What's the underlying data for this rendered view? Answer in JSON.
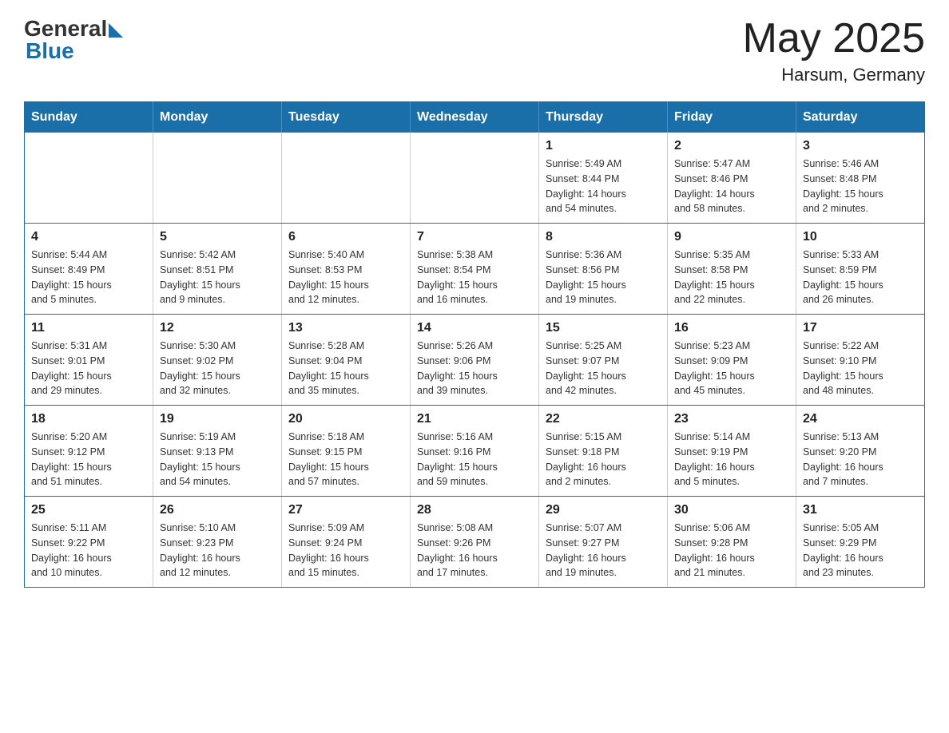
{
  "header": {
    "logo_general": "General",
    "logo_blue": "Blue",
    "title": "May 2025",
    "location": "Harsum, Germany"
  },
  "days_of_week": [
    "Sunday",
    "Monday",
    "Tuesday",
    "Wednesday",
    "Thursday",
    "Friday",
    "Saturday"
  ],
  "weeks": [
    [
      {
        "day": "",
        "info": ""
      },
      {
        "day": "",
        "info": ""
      },
      {
        "day": "",
        "info": ""
      },
      {
        "day": "",
        "info": ""
      },
      {
        "day": "1",
        "info": "Sunrise: 5:49 AM\nSunset: 8:44 PM\nDaylight: 14 hours\nand 54 minutes."
      },
      {
        "day": "2",
        "info": "Sunrise: 5:47 AM\nSunset: 8:46 PM\nDaylight: 14 hours\nand 58 minutes."
      },
      {
        "day": "3",
        "info": "Sunrise: 5:46 AM\nSunset: 8:48 PM\nDaylight: 15 hours\nand 2 minutes."
      }
    ],
    [
      {
        "day": "4",
        "info": "Sunrise: 5:44 AM\nSunset: 8:49 PM\nDaylight: 15 hours\nand 5 minutes."
      },
      {
        "day": "5",
        "info": "Sunrise: 5:42 AM\nSunset: 8:51 PM\nDaylight: 15 hours\nand 9 minutes."
      },
      {
        "day": "6",
        "info": "Sunrise: 5:40 AM\nSunset: 8:53 PM\nDaylight: 15 hours\nand 12 minutes."
      },
      {
        "day": "7",
        "info": "Sunrise: 5:38 AM\nSunset: 8:54 PM\nDaylight: 15 hours\nand 16 minutes."
      },
      {
        "day": "8",
        "info": "Sunrise: 5:36 AM\nSunset: 8:56 PM\nDaylight: 15 hours\nand 19 minutes."
      },
      {
        "day": "9",
        "info": "Sunrise: 5:35 AM\nSunset: 8:58 PM\nDaylight: 15 hours\nand 22 minutes."
      },
      {
        "day": "10",
        "info": "Sunrise: 5:33 AM\nSunset: 8:59 PM\nDaylight: 15 hours\nand 26 minutes."
      }
    ],
    [
      {
        "day": "11",
        "info": "Sunrise: 5:31 AM\nSunset: 9:01 PM\nDaylight: 15 hours\nand 29 minutes."
      },
      {
        "day": "12",
        "info": "Sunrise: 5:30 AM\nSunset: 9:02 PM\nDaylight: 15 hours\nand 32 minutes."
      },
      {
        "day": "13",
        "info": "Sunrise: 5:28 AM\nSunset: 9:04 PM\nDaylight: 15 hours\nand 35 minutes."
      },
      {
        "day": "14",
        "info": "Sunrise: 5:26 AM\nSunset: 9:06 PM\nDaylight: 15 hours\nand 39 minutes."
      },
      {
        "day": "15",
        "info": "Sunrise: 5:25 AM\nSunset: 9:07 PM\nDaylight: 15 hours\nand 42 minutes."
      },
      {
        "day": "16",
        "info": "Sunrise: 5:23 AM\nSunset: 9:09 PM\nDaylight: 15 hours\nand 45 minutes."
      },
      {
        "day": "17",
        "info": "Sunrise: 5:22 AM\nSunset: 9:10 PM\nDaylight: 15 hours\nand 48 minutes."
      }
    ],
    [
      {
        "day": "18",
        "info": "Sunrise: 5:20 AM\nSunset: 9:12 PM\nDaylight: 15 hours\nand 51 minutes."
      },
      {
        "day": "19",
        "info": "Sunrise: 5:19 AM\nSunset: 9:13 PM\nDaylight: 15 hours\nand 54 minutes."
      },
      {
        "day": "20",
        "info": "Sunrise: 5:18 AM\nSunset: 9:15 PM\nDaylight: 15 hours\nand 57 minutes."
      },
      {
        "day": "21",
        "info": "Sunrise: 5:16 AM\nSunset: 9:16 PM\nDaylight: 15 hours\nand 59 minutes."
      },
      {
        "day": "22",
        "info": "Sunrise: 5:15 AM\nSunset: 9:18 PM\nDaylight: 16 hours\nand 2 minutes."
      },
      {
        "day": "23",
        "info": "Sunrise: 5:14 AM\nSunset: 9:19 PM\nDaylight: 16 hours\nand 5 minutes."
      },
      {
        "day": "24",
        "info": "Sunrise: 5:13 AM\nSunset: 9:20 PM\nDaylight: 16 hours\nand 7 minutes."
      }
    ],
    [
      {
        "day": "25",
        "info": "Sunrise: 5:11 AM\nSunset: 9:22 PM\nDaylight: 16 hours\nand 10 minutes."
      },
      {
        "day": "26",
        "info": "Sunrise: 5:10 AM\nSunset: 9:23 PM\nDaylight: 16 hours\nand 12 minutes."
      },
      {
        "day": "27",
        "info": "Sunrise: 5:09 AM\nSunset: 9:24 PM\nDaylight: 16 hours\nand 15 minutes."
      },
      {
        "day": "28",
        "info": "Sunrise: 5:08 AM\nSunset: 9:26 PM\nDaylight: 16 hours\nand 17 minutes."
      },
      {
        "day": "29",
        "info": "Sunrise: 5:07 AM\nSunset: 9:27 PM\nDaylight: 16 hours\nand 19 minutes."
      },
      {
        "day": "30",
        "info": "Sunrise: 5:06 AM\nSunset: 9:28 PM\nDaylight: 16 hours\nand 21 minutes."
      },
      {
        "day": "31",
        "info": "Sunrise: 5:05 AM\nSunset: 9:29 PM\nDaylight: 16 hours\nand 23 minutes."
      }
    ]
  ]
}
